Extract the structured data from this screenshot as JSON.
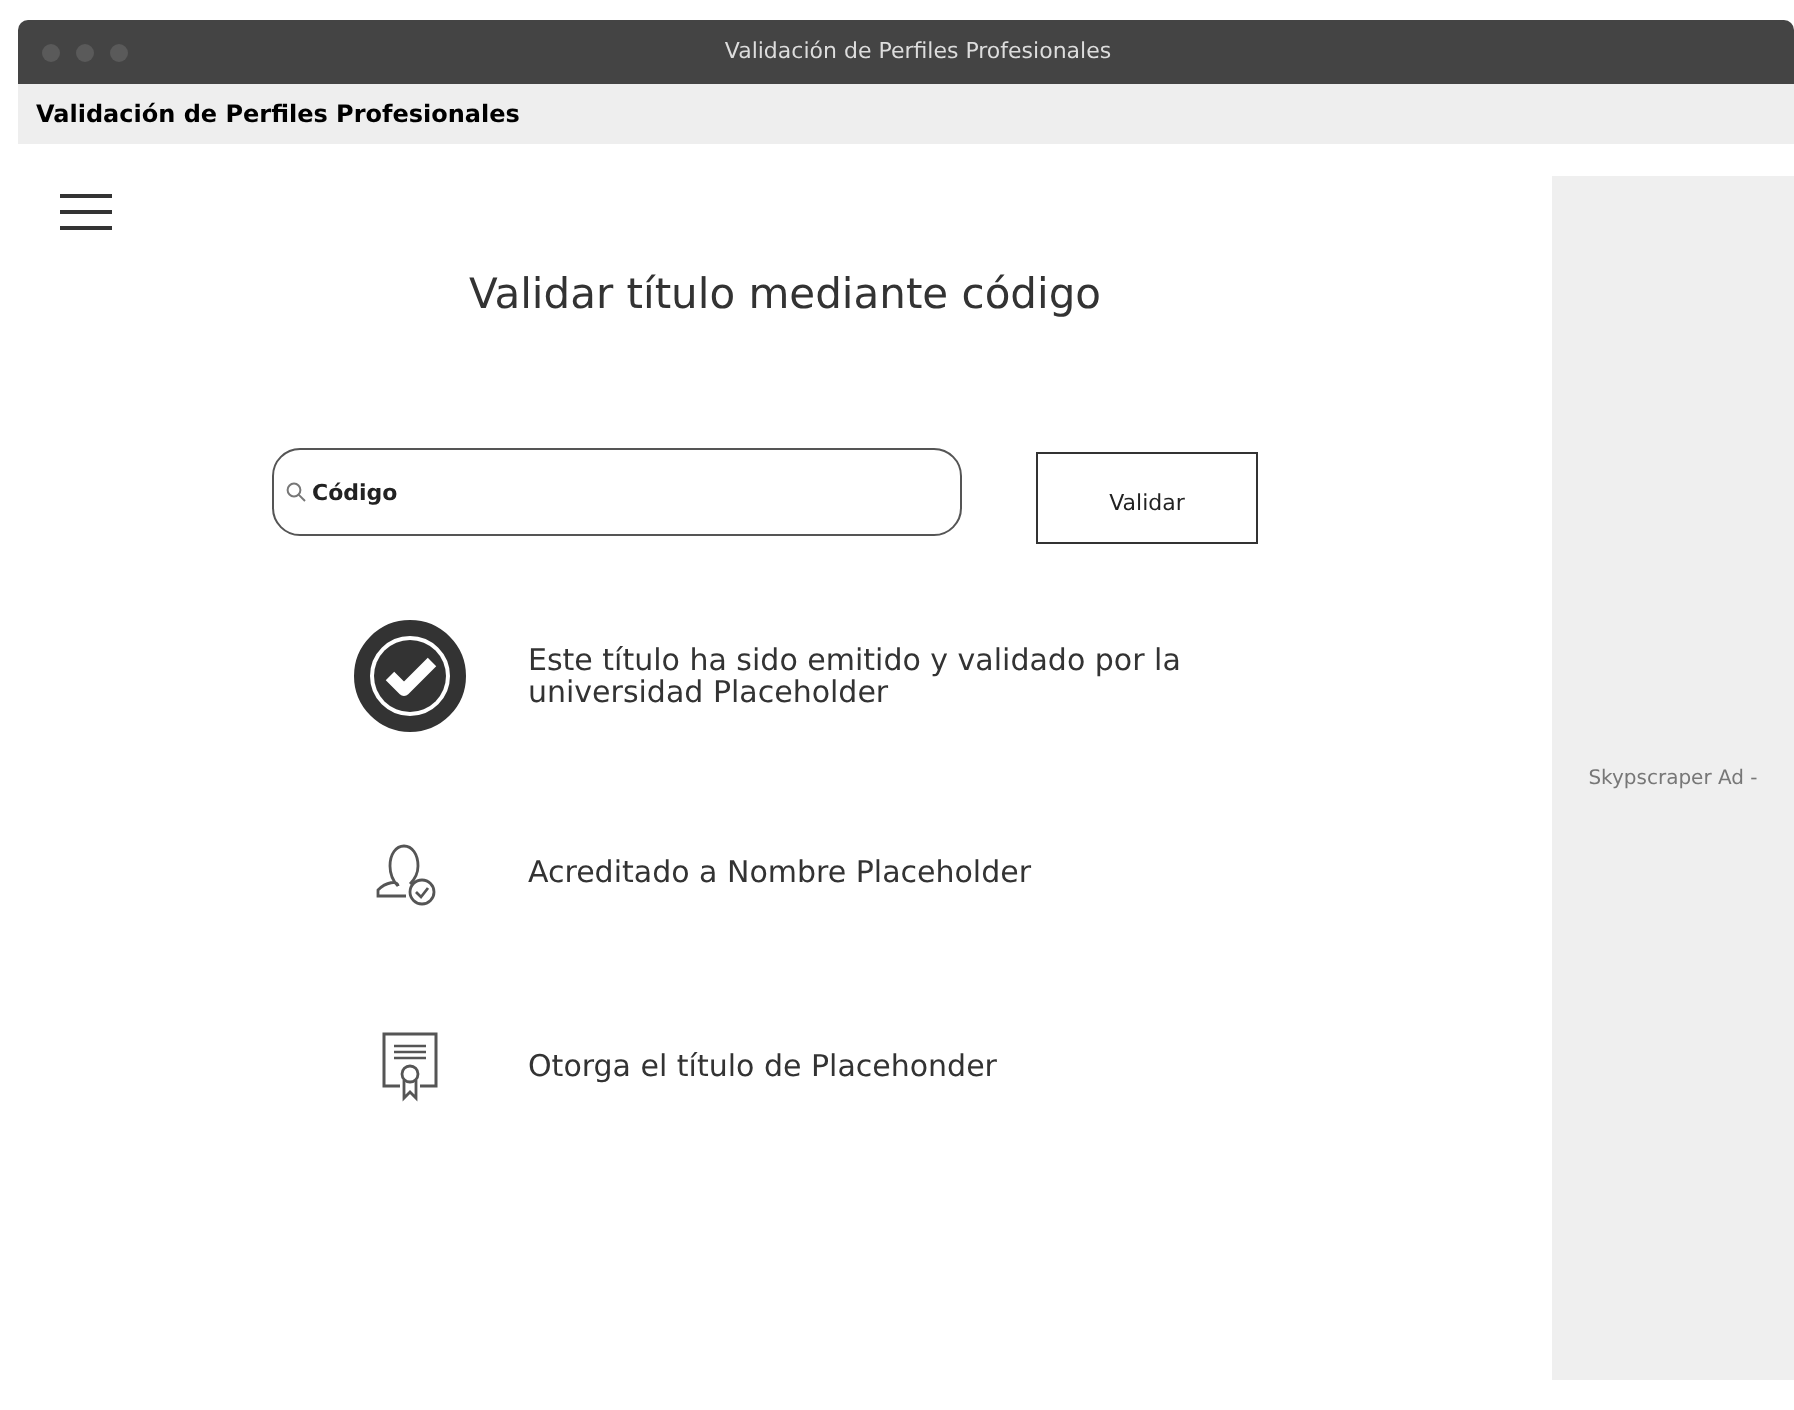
{
  "window": {
    "title": "Validación de Perfiles Profesionales"
  },
  "header": {
    "title": "Validación de Perfiles Profesionales"
  },
  "heading": "Validar título mediante código",
  "search": {
    "placeholder": "Código"
  },
  "button": "Validar",
  "results": [
    {
      "kind": "check",
      "text": "Este título ha sido emitido y validado por la universidad Placeholder"
    },
    {
      "kind": "person",
      "text": "Acreditado a Nombre Placeholder"
    },
    {
      "kind": "certificate",
      "text": "Otorga el título de Placehonder"
    }
  ],
  "ad": {
    "label": "Skypscraper Ad -"
  }
}
